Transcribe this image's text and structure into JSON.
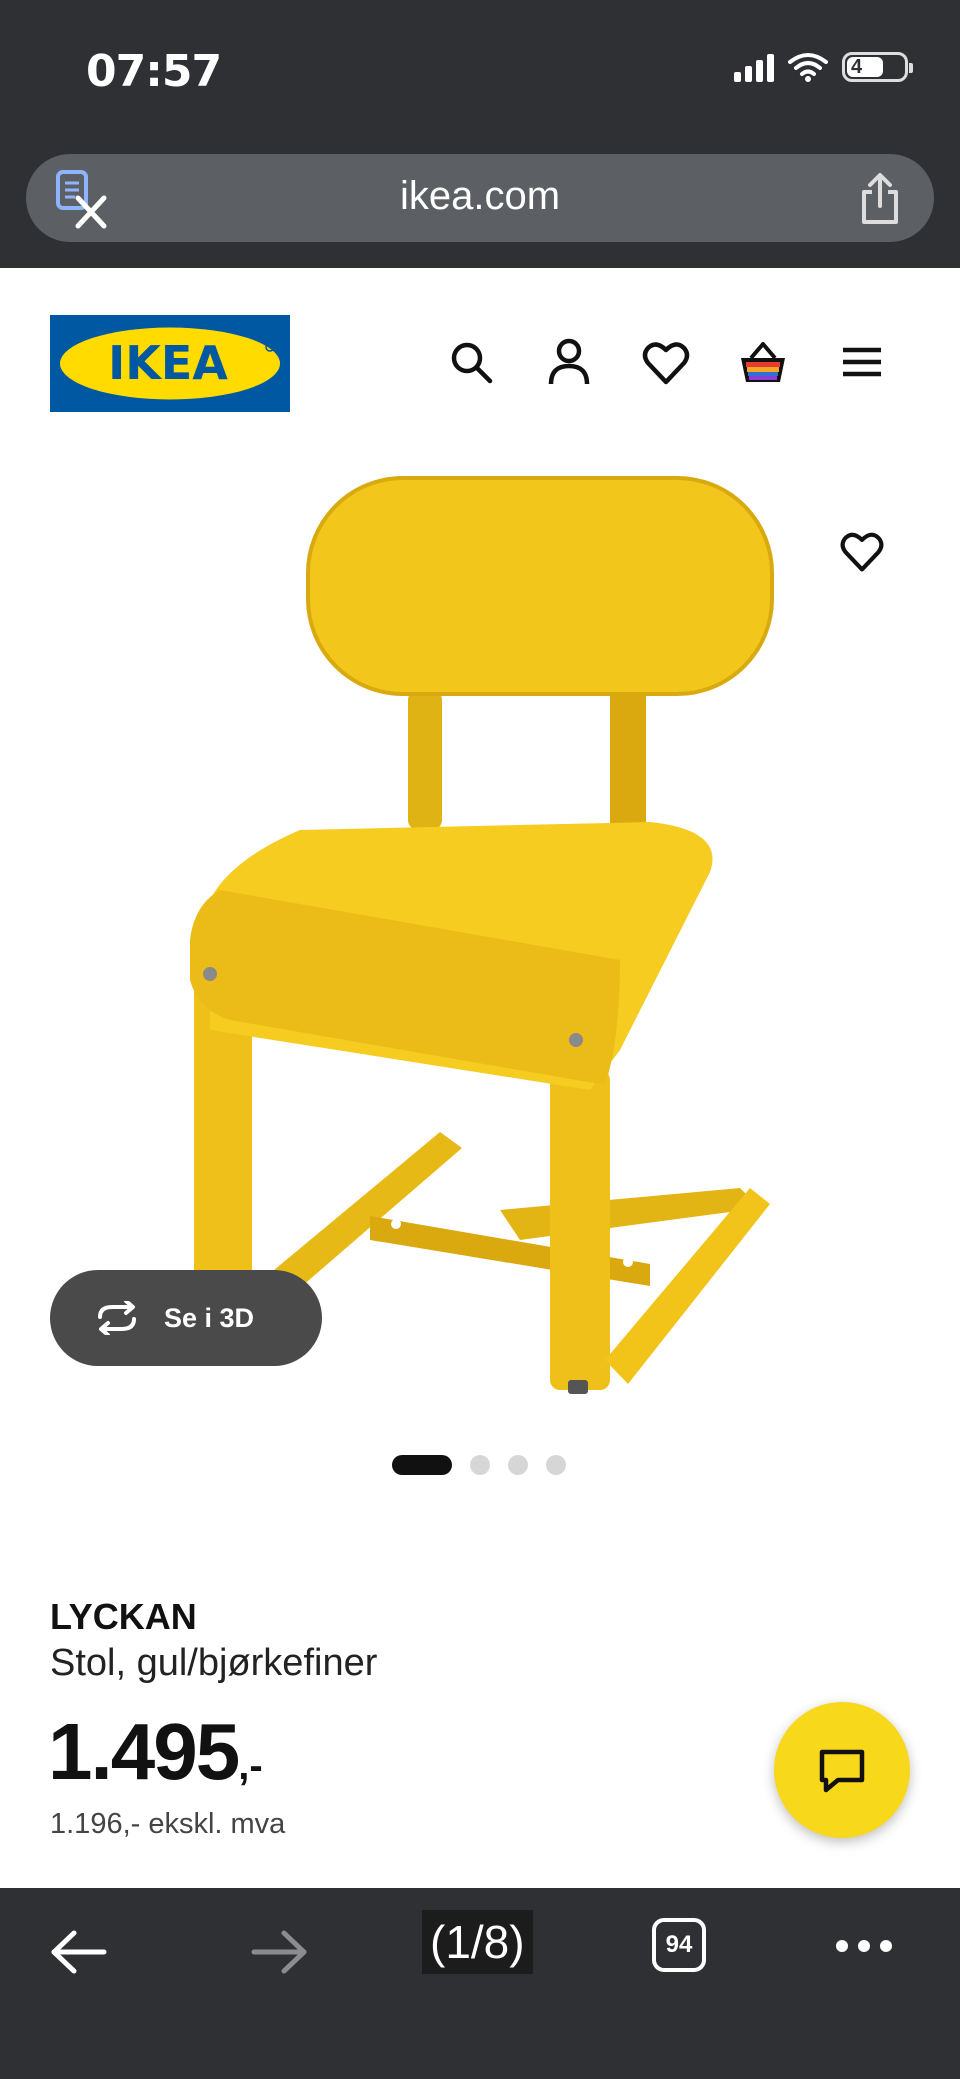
{
  "status_bar": {
    "time": "07:57",
    "battery_level": "4"
  },
  "browser": {
    "url": "ikea.com",
    "page_counter": "(1/8)",
    "tab_count": "94"
  },
  "header": {
    "logo_text": "IKEA",
    "brand_colors": {
      "blue": "#0058a3",
      "yellow": "#ffdb00"
    },
    "icons": [
      "search-icon",
      "user-icon",
      "heart-icon",
      "basket-icon",
      "menu-icon"
    ]
  },
  "gallery": {
    "view_3d_label": "Se i 3D",
    "slide_count": 4,
    "active_slide": 1
  },
  "product": {
    "name": "LYCKAN",
    "description": "Stol, gul/bjørkefiner",
    "price": "1.495",
    "price_suffix": ",-",
    "price_ex_vat": "1.196,- ekskl. mva"
  },
  "colors": {
    "chrome": "#2e3034",
    "chat_button": "#f8d81b",
    "chair": "#f2c51a"
  }
}
